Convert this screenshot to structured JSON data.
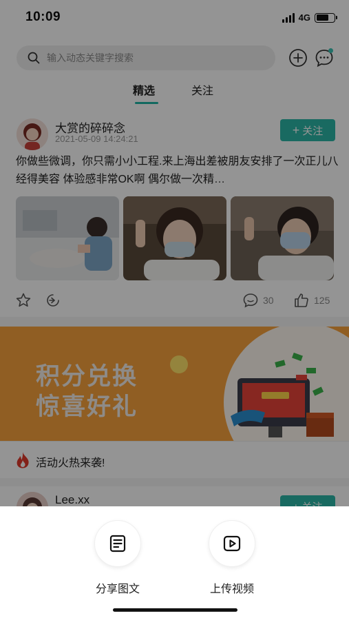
{
  "status_bar": {
    "time": "10:09",
    "network": "4G"
  },
  "search": {
    "placeholder": "输入动态关键字搜索"
  },
  "tabs": [
    {
      "label": "精选",
      "active": true
    },
    {
      "label": "关注",
      "active": false
    }
  ],
  "post": {
    "author": "大赏的碎碎念",
    "timestamp": "2021-05-09  14:24:21",
    "follow_label": "关注",
    "text": "你做些微调，你只需小小工程.来上海出差被朋友安排了一次正儿八经得美容 体验感非常OK啊 偶尔做一次精…",
    "image_count": 3,
    "comments": "30",
    "likes": "125"
  },
  "banner": {
    "line1": "积分兑换",
    "line2": "惊喜好礼"
  },
  "activity": {
    "label": "活动火热来袭!"
  },
  "post2": {
    "author": "Lee.xx",
    "follow_label": "+ 关注"
  },
  "sheet": {
    "options": [
      {
        "label": "分享图文",
        "icon": "document-icon"
      },
      {
        "label": "上传视频",
        "icon": "video-icon"
      }
    ]
  },
  "colors": {
    "accent": "#2bb7a7",
    "banner": "#f9a33d",
    "overlay": "rgba(0,0,0,0.42)"
  }
}
